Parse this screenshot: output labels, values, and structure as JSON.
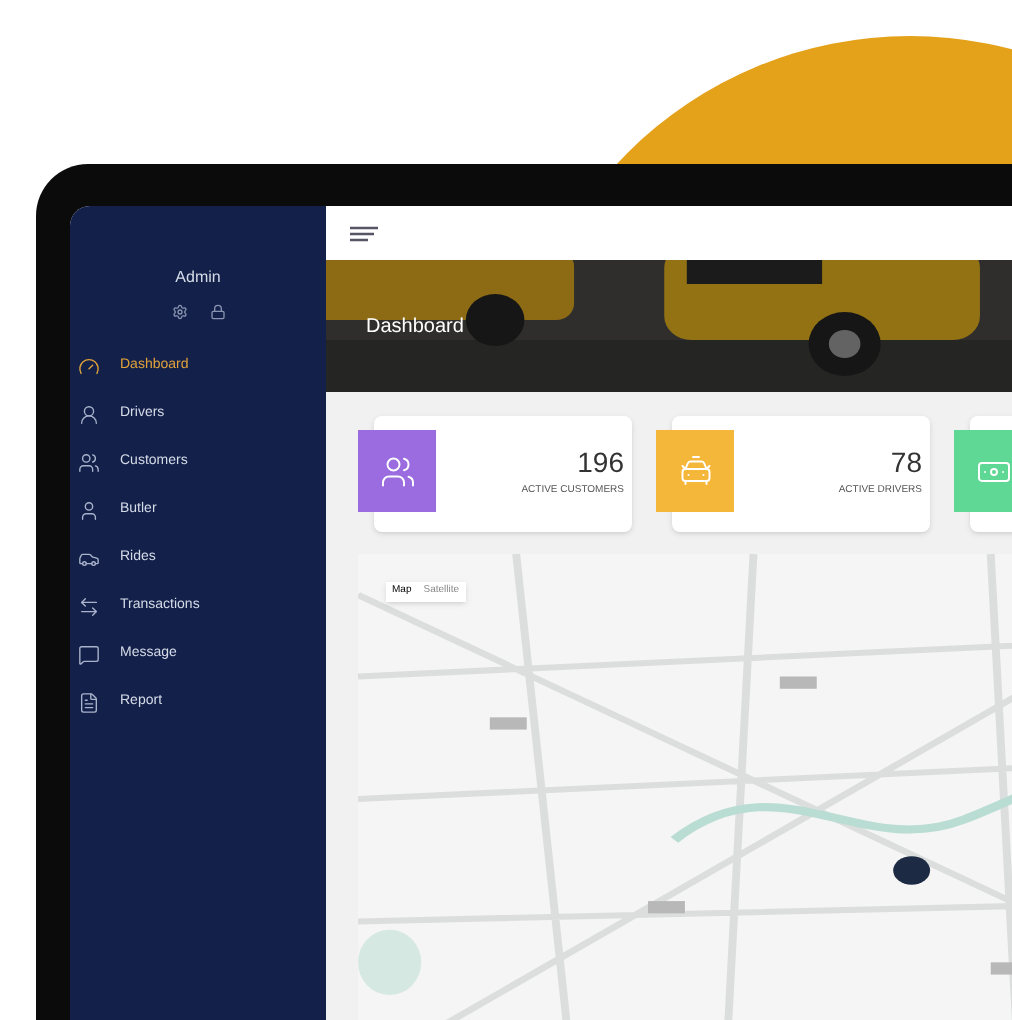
{
  "sidebar": {
    "user": "Admin",
    "items": [
      {
        "label": "Dashboard",
        "kind": "dashboard",
        "selected": true
      },
      {
        "label": "Drivers",
        "kind": "driver",
        "selected": false
      },
      {
        "label": "Customers",
        "kind": "customers",
        "selected": false
      },
      {
        "label": "Butler",
        "kind": "butler",
        "selected": false
      },
      {
        "label": "Rides",
        "kind": "car",
        "selected": false
      },
      {
        "label": "Transactions",
        "kind": "transactions",
        "selected": false
      },
      {
        "label": "Message",
        "kind": "message",
        "selected": false
      },
      {
        "label": "Report",
        "kind": "report",
        "selected": false
      }
    ]
  },
  "header": {
    "title": "Dashboard"
  },
  "stats": [
    {
      "value": "196",
      "label": "ACTIVE CUSTOMERS",
      "kind": "customers",
      "color": "#9b6be0"
    },
    {
      "value": "78",
      "label": "ACTIVE DRIVERS",
      "kind": "taxi",
      "color": "#f5b73a"
    },
    {
      "kind": "cash",
      "color": "#5fd895"
    }
  ],
  "map": {
    "controls": [
      {
        "label": "Map",
        "selected": true
      },
      {
        "label": "Satellite",
        "selected": false
      }
    ]
  }
}
